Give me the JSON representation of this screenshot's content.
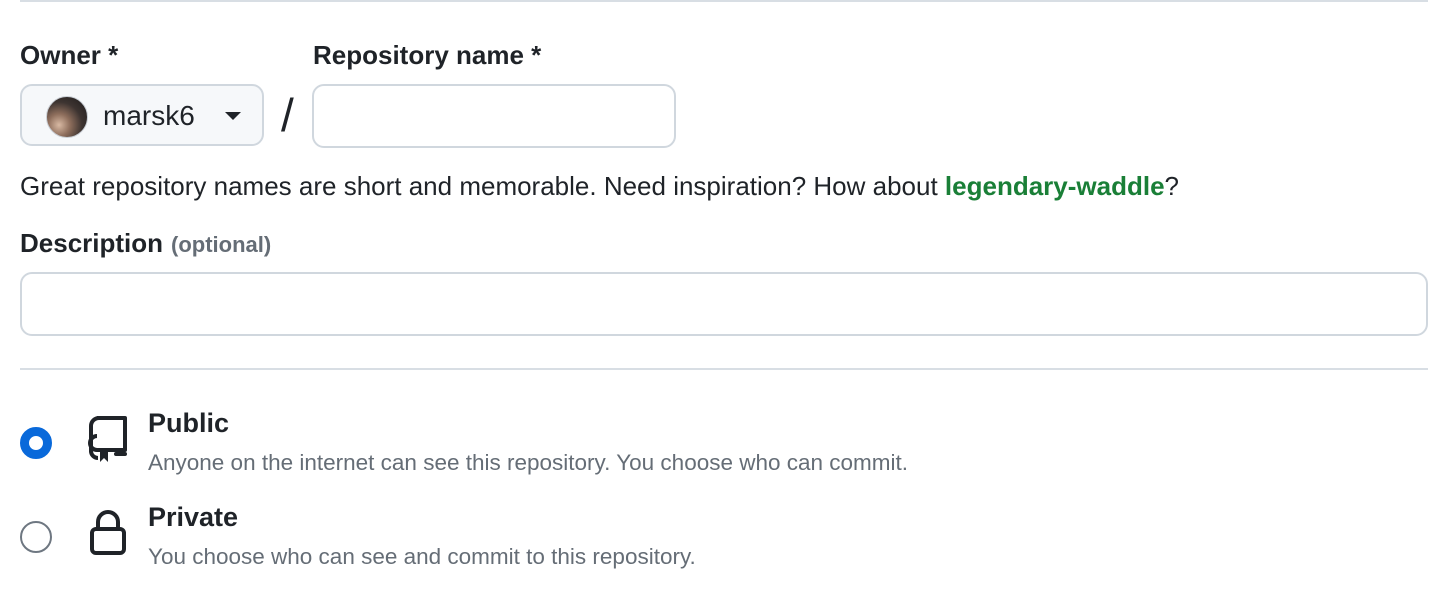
{
  "owner": {
    "label": "Owner *",
    "selected": "marsk6"
  },
  "repository": {
    "label": "Repository name *",
    "value": ""
  },
  "separator": "/",
  "hint": {
    "text": "Great repository names are short and memorable. Need inspiration? How about ",
    "suggestion": "legendary-waddle",
    "suffix": "?"
  },
  "description": {
    "label": "Description",
    "optional": "(optional)",
    "value": ""
  },
  "visibility": {
    "selected": "public",
    "options": [
      {
        "id": "public",
        "title": "Public",
        "desc": "Anyone on the internet can see this repository. You choose who can commit.",
        "icon": "repo-icon"
      },
      {
        "id": "private",
        "title": "Private",
        "desc": "You choose who can see and commit to this repository.",
        "icon": "lock-icon"
      }
    ]
  },
  "colors": {
    "accent": "#0969da",
    "link": "#1a7f37",
    "muted": "#656d76",
    "border": "#d0d7de"
  }
}
